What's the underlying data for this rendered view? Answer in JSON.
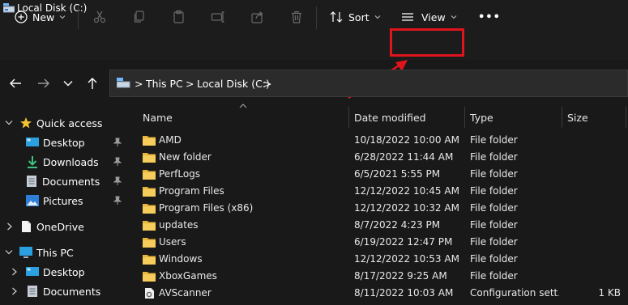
{
  "window": {
    "title": "Local Disk (C:)"
  },
  "toolbar": {
    "new_label": "New",
    "sort_label": "Sort",
    "view_label": "View",
    "more_label": "•••",
    "icons": [
      "cut-icon",
      "copy-icon",
      "paste-icon",
      "rename-icon",
      "share-icon",
      "delete-icon"
    ]
  },
  "address": {
    "crumbs": [
      "This PC",
      "Local Disk (C:)"
    ],
    "separator": ">"
  },
  "sidebar": {
    "items": [
      {
        "label": "Quick access",
        "icon": "star-icon"
      },
      {
        "label": "Desktop",
        "icon": "desktop-icon"
      },
      {
        "label": "Downloads",
        "icon": "download-icon"
      },
      {
        "label": "Documents",
        "icon": "documents-icon"
      },
      {
        "label": "Pictures",
        "icon": "pictures-icon"
      },
      {
        "label": "OneDrive",
        "icon": "file-icon"
      },
      {
        "label": "This PC",
        "icon": "computer-icon"
      },
      {
        "label": "Desktop",
        "icon": "desktop-icon"
      },
      {
        "label": "Documents",
        "icon": "documents-icon"
      }
    ]
  },
  "columns": {
    "name": "Name",
    "date": "Date modified",
    "type": "Type",
    "size": "Size"
  },
  "files": [
    {
      "name": "AMD",
      "date": "10/18/2022 10:00 AM",
      "type": "File folder",
      "size": ""
    },
    {
      "name": "New folder",
      "date": "6/28/2022 11:44 AM",
      "type": "File folder",
      "size": ""
    },
    {
      "name": "PerfLogs",
      "date": "6/5/2021 5:55 PM",
      "type": "File folder",
      "size": ""
    },
    {
      "name": "Program Files",
      "date": "12/12/2022 10:45 AM",
      "type": "File folder",
      "size": ""
    },
    {
      "name": "Program Files (x86)",
      "date": "12/12/2022 10:32 AM",
      "type": "File folder",
      "size": ""
    },
    {
      "name": "updates",
      "date": "8/7/2022 4:23 PM",
      "type": "File folder",
      "size": ""
    },
    {
      "name": "Users",
      "date": "6/19/2022 12:47 PM",
      "type": "File folder",
      "size": ""
    },
    {
      "name": "Windows",
      "date": "12/12/2022 10:53 AM",
      "type": "File folder",
      "size": ""
    },
    {
      "name": "XboxGames",
      "date": "8/17/2022 9:25 AM",
      "type": "File folder",
      "size": ""
    },
    {
      "name": "AVScanner",
      "date": "8/11/2022 10:03 AM",
      "type": "Configuration sett...",
      "size": "1 KB"
    }
  ],
  "colors": {
    "background": "#191919",
    "highlight": "#e0141c",
    "folder": "#e8b43a",
    "accent": "#4cc2ff"
  }
}
